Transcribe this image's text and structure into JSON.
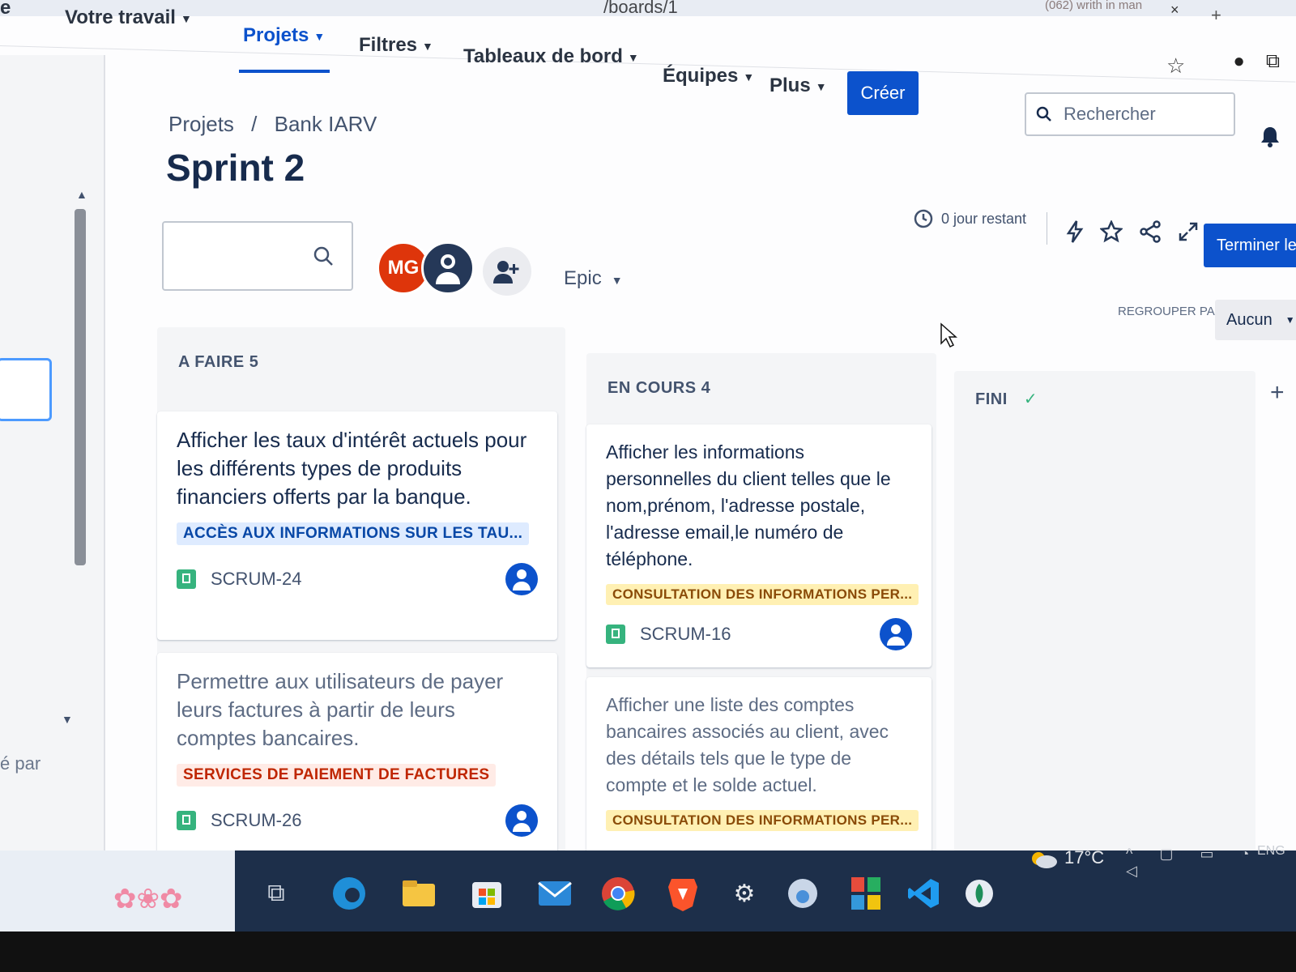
{
  "browser": {
    "url_fragment": "/boards/1",
    "tab_fragment": "(062) writh in man",
    "tab_close": "×",
    "tab_new": "+"
  },
  "nav": {
    "partial_left": "e",
    "items": [
      {
        "label": "Votre travail",
        "active": false
      },
      {
        "label": "Projets",
        "active": true
      },
      {
        "label": "Filtres",
        "active": false
      },
      {
        "label": "Tableaux de bord",
        "active": false
      },
      {
        "label": "Équipes",
        "active": false
      },
      {
        "label": "Plus",
        "active": false
      }
    ],
    "create_label": "Créer",
    "search_placeholder": "Rechercher"
  },
  "sidebar": {
    "partial_text": "é par"
  },
  "breadcrumb": {
    "projects": "Projets",
    "separator": "/",
    "project": "Bank IARV"
  },
  "page_title": "Sprint 2",
  "toolbar": {
    "avatar_initials": "MG",
    "epic_filter": "Epic",
    "time_remaining": "0 jour restant",
    "finish_label": "Terminer le",
    "group_by_label": "REGROUPER PAR",
    "group_by_value": "Aucun"
  },
  "columns": {
    "todo": {
      "title": "A FAIRE 5",
      "cards": [
        {
          "title": "Afficher les taux d'intérêt actuels pour les différents types de produits financiers offerts par la banque.",
          "epic": "ACCÈS AUX INFORMATIONS SUR LES TAU...",
          "key": "SCRUM-24"
        },
        {
          "title": "Permettre aux utilisateurs de payer leurs factures à partir de leurs comptes bancaires.",
          "epic": "SERVICES DE PAIEMENT DE FACTURES",
          "key": "SCRUM-26"
        }
      ]
    },
    "in_progress": {
      "title": "EN COURS 4",
      "cards": [
        {
          "title": "Afficher les informations personnelles du client telles que le nom,prénom, l'adresse postale, l'adresse email,le numéro de téléphone.",
          "epic": "CONSULTATION DES INFORMATIONS PER...",
          "key": "SCRUM-16"
        },
        {
          "title": "Afficher une liste des comptes bancaires associés au client, avec des détails tels que le type de compte et le solde actuel.",
          "epic": "CONSULTATION DES INFORMATIONS PER..."
        }
      ]
    },
    "done": {
      "title": "FINI",
      "check": "✓"
    }
  },
  "taskbar": {
    "temperature": "17°C",
    "language": "ENG"
  },
  "colors": {
    "brand_blue": "#0c52cc",
    "avatar_red": "#de350b",
    "story_green": "#36b37e"
  },
  "icons": [
    "search-icon",
    "clock-icon",
    "lightning-icon",
    "star-icon",
    "share-icon",
    "expand-icon",
    "add-person-icon",
    "user-icon",
    "story-icon",
    "plus-icon",
    "bell-icon"
  ]
}
